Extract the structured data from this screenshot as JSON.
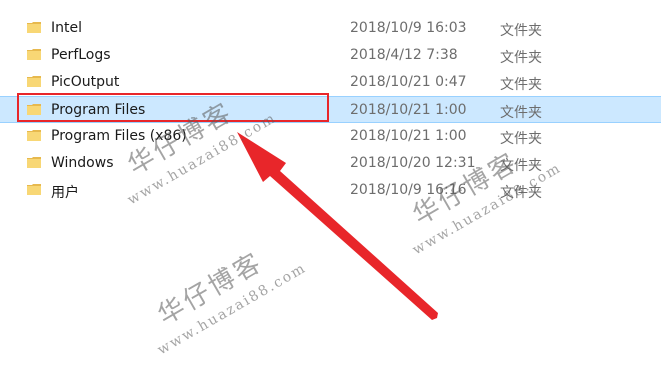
{
  "files": [
    {
      "name": "Intel",
      "date": "2018/10/9 16:03",
      "type": "文件夹",
      "selected": false
    },
    {
      "name": "PerfLogs",
      "date": "2018/4/12 7:38",
      "type": "文件夹",
      "selected": false
    },
    {
      "name": "PicOutput",
      "date": "2018/10/21 0:47",
      "type": "文件夹",
      "selected": false
    },
    {
      "name": "Program Files",
      "date": "2018/10/21 1:00",
      "type": "文件夹",
      "selected": true
    },
    {
      "name": "Program Files (x86)",
      "date": "2018/10/21 1:00",
      "type": "文件夹",
      "selected": false
    },
    {
      "name": "Windows",
      "date": "2018/10/20 12:31",
      "type": "文件夹",
      "selected": false
    },
    {
      "name": "用户",
      "date": "2018/10/9 16:16",
      "type": "文件夹",
      "selected": false
    }
  ],
  "watermark": {
    "text": "华仔博客",
    "url": "www.huazai88.com"
  },
  "colors": {
    "selection_bg": "#cce8ff",
    "selection_border": "#99d1ff",
    "annotation_red": "#e8262a",
    "folder_yellow": "#f8d775"
  },
  "icons": {
    "folder": "folder-icon",
    "annotation_arrow": "red-arrow"
  }
}
